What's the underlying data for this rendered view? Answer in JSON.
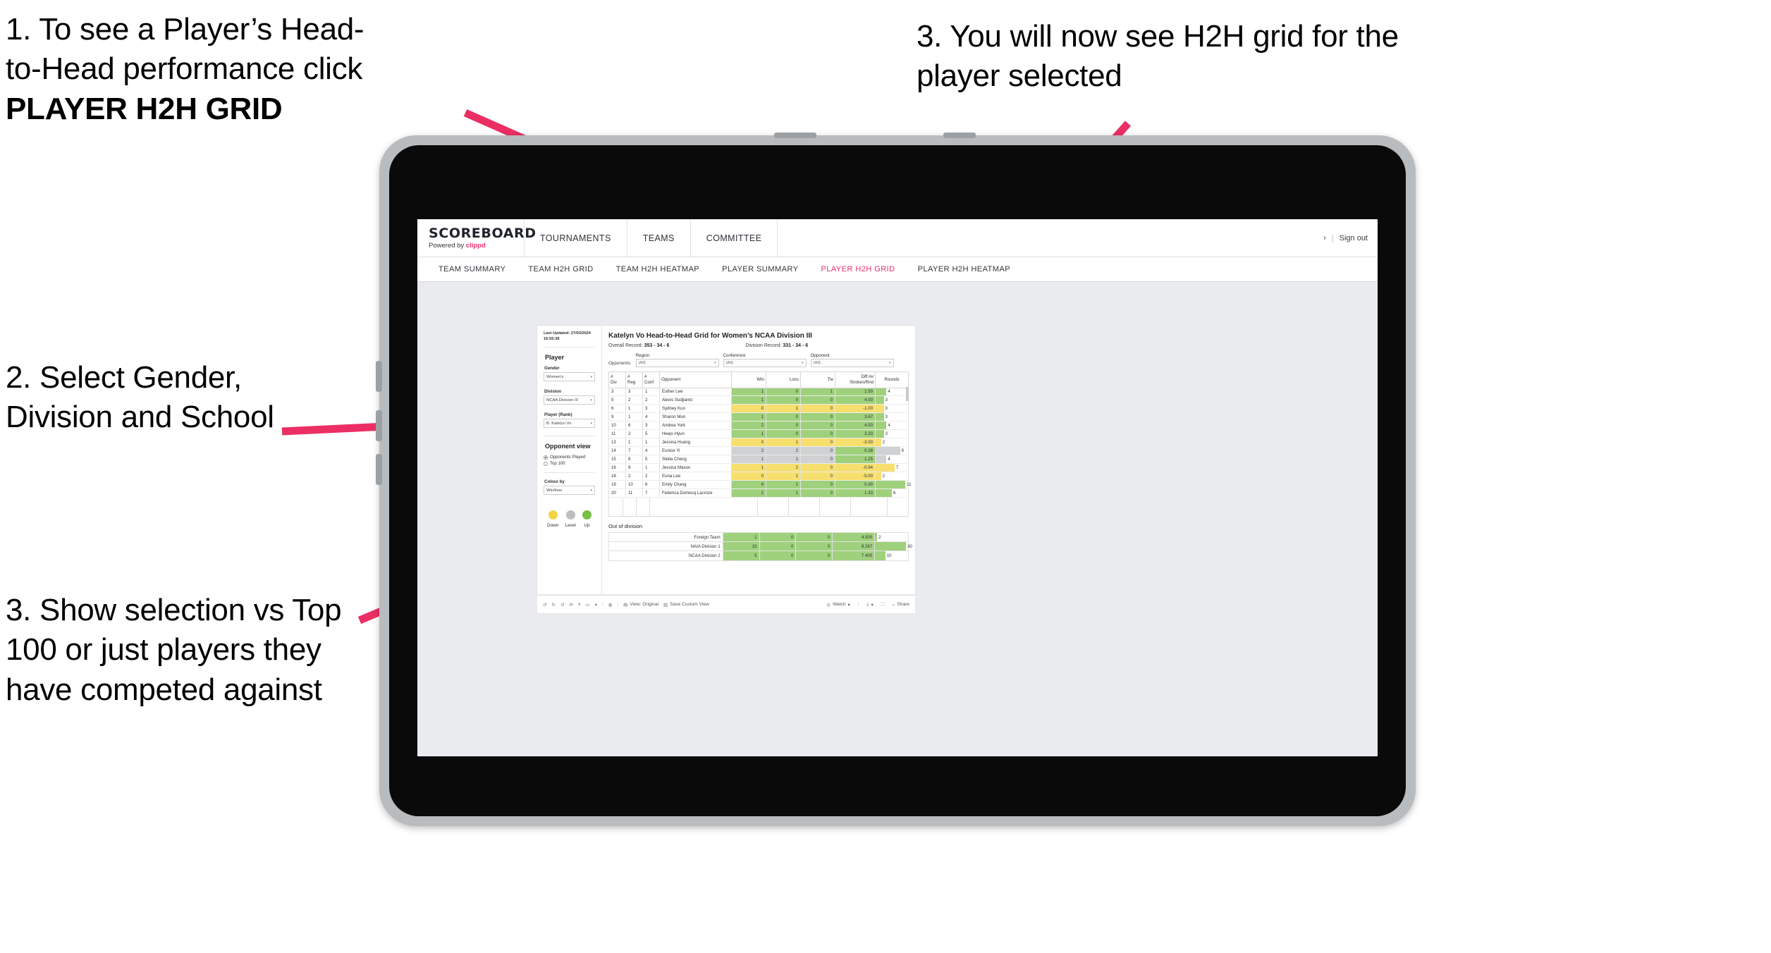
{
  "annotations": {
    "a1_line1": "1. To see a Player’s Head-",
    "a1_line2": "to-Head performance click",
    "a1_bold": "PLAYER H2H GRID",
    "a2": "2. Select Gender, Division and School",
    "a3": "3. Show selection vs Top 100 or just players they have competed against",
    "a4": "3. You will now see H2H grid for the player selected",
    "arrow_color": "#eb2f64"
  },
  "app": {
    "brand": {
      "name": "SCOREBOARD",
      "powered_prefix": "Powered by ",
      "powered_brand": "clippd"
    },
    "top_nav": [
      "TOURNAMENTS",
      "TEAMS",
      "COMMITTEE"
    ],
    "top_right": {
      "chevron": "›",
      "separator": "|",
      "sign_out": "Sign out"
    },
    "tabs": [
      {
        "label": "TEAM SUMMARY",
        "active": false
      },
      {
        "label": "TEAM H2H GRID",
        "active": false
      },
      {
        "label": "TEAM H2H HEATMAP",
        "active": false
      },
      {
        "label": "PLAYER SUMMARY",
        "active": false
      },
      {
        "label": "PLAYER H2H GRID",
        "active": true
      },
      {
        "label": "PLAYER H2H HEATMAP",
        "active": false
      }
    ],
    "accent": "#e8336d"
  },
  "sidebar": {
    "last_updated": "Last Updated: 27/03/2024 16:55:38",
    "player_heading": "Player",
    "fields": [
      {
        "label": "Gender",
        "value": "Women’s"
      },
      {
        "label": "Division",
        "value": "NCAA Division III"
      },
      {
        "label": "Player (Rank)",
        "value": "B. Katelyn Vo"
      }
    ],
    "opponent_view": {
      "heading": "Opponent view",
      "options": [
        {
          "label": "Opponents Played",
          "selected": true
        },
        {
          "label": "Top 100",
          "selected": false
        }
      ]
    },
    "colour_by": {
      "label": "Colour by",
      "value": "Win/loss"
    },
    "legend": [
      {
        "label": "Down",
        "color": "#f2d544"
      },
      {
        "label": "Level",
        "color": "#bcbec0"
      },
      {
        "label": "Up",
        "color": "#76c043"
      }
    ]
  },
  "viz": {
    "title": "Katelyn Vo Head-to-Head Grid for Women’s NCAA Division III",
    "overall_record_label": "Overall Record: ",
    "overall_record_value": "353 - 34 - 6",
    "division_record_label": "Division Record: ",
    "division_record_value": "331 - 34 - 6",
    "opponents_label": "Opponents:",
    "filters": [
      {
        "label": "Region",
        "value": "(All)"
      },
      {
        "label": "Conference",
        "value": "(All)"
      },
      {
        "label": "Opponent",
        "value": "(All)"
      }
    ],
    "out_of_division_title": "Out of division"
  },
  "chart_data": {
    "type": "table",
    "title": "Katelyn Vo Head-to-Head Grid for Women’s NCAA Division III",
    "columns": [
      "# Div",
      "# Reg",
      "# Conf",
      "Opponent",
      "Win",
      "Loss",
      "Tie",
      "Diff Av Strokes/Rnd",
      "Rounds"
    ],
    "column_headers_two_line": [
      [
        "#",
        "Div"
      ],
      [
        "#",
        "Reg"
      ],
      [
        "#",
        "Conf"
      ],
      [
        "Opponent",
        ""
      ],
      [
        "Win",
        ""
      ],
      [
        "Loss",
        ""
      ],
      [
        "Tie",
        ""
      ],
      [
        "Diff Av",
        "Strokes/Rnd"
      ],
      [
        "Rounds",
        ""
      ]
    ],
    "rounds_max": 12,
    "colors": {
      "up": "#9fd17c",
      "down": "#f7df6e",
      "level": "#cfd1d2"
    },
    "rows": [
      {
        "div": "3",
        "reg": "3",
        "conf": "1",
        "opponent": "Esther Lee",
        "win": "1",
        "loss": "0",
        "tie": "1",
        "diff": "1.50",
        "rounds": "4",
        "state": "g"
      },
      {
        "div": "5",
        "reg": "2",
        "conf": "2",
        "opponent": "Alexis Sudjianto",
        "win": "1",
        "loss": "0",
        "tie": "0",
        "diff": "4.00",
        "rounds": "3",
        "state": "g"
      },
      {
        "div": "6",
        "reg": "1",
        "conf": "3",
        "opponent": "Sydney Kuo",
        "win": "0",
        "loss": "1",
        "tie": "0",
        "diff": "-1.00",
        "rounds": "3",
        "state": "y"
      },
      {
        "div": "9",
        "reg": "1",
        "conf": "4",
        "opponent": "Sharon Mun",
        "win": "1",
        "loss": "0",
        "tie": "0",
        "diff": "3.67",
        "rounds": "3",
        "state": "g"
      },
      {
        "div": "10",
        "reg": "6",
        "conf": "3",
        "opponent": "Andrea York",
        "win": "2",
        "loss": "0",
        "tie": "0",
        "diff": "4.00",
        "rounds": "4",
        "state": "g"
      },
      {
        "div": "11",
        "reg": "2",
        "conf": "5",
        "opponent": "Heejo Hyun",
        "win": "1",
        "loss": "0",
        "tie": "0",
        "diff": "3.33",
        "rounds": "3",
        "state": "g"
      },
      {
        "div": "13",
        "reg": "1",
        "conf": "1",
        "opponent": "Jessica Huang",
        "win": "0",
        "loss": "1",
        "tie": "0",
        "diff": "-3.00",
        "rounds": "2",
        "state": "y"
      },
      {
        "div": "14",
        "reg": "7",
        "conf": "4",
        "opponent": "Eunice Yi",
        "win": "2",
        "loss": "2",
        "tie": "0",
        "diff": "0.38",
        "rounds": "9",
        "state": "n",
        "diff_state": "g"
      },
      {
        "div": "15",
        "reg": "8",
        "conf": "5",
        "opponent": "Stella Cheng",
        "win": "1",
        "loss": "1",
        "tie": "0",
        "diff": "1.25",
        "rounds": "4",
        "state": "n",
        "diff_state": "g"
      },
      {
        "div": "16",
        "reg": "9",
        "conf": "1",
        "opponent": "Jessica Mason",
        "win": "1",
        "loss": "2",
        "tie": "0",
        "diff": "-0.94",
        "rounds": "7",
        "state": "y"
      },
      {
        "div": "18",
        "reg": "2",
        "conf": "2",
        "opponent": "Euna Lee",
        "win": "0",
        "loss": "1",
        "tie": "0",
        "diff": "-5.00",
        "rounds": "2",
        "state": "y"
      },
      {
        "div": "19",
        "reg": "10",
        "conf": "6",
        "opponent": "Emily Chang",
        "win": "4",
        "loss": "1",
        "tie": "0",
        "diff": "0.30",
        "rounds": "11",
        "state": "g"
      },
      {
        "div": "20",
        "reg": "11",
        "conf": "7",
        "opponent": "Federica Domecq Lacroze",
        "win": "2",
        "loss": "1",
        "tie": "0",
        "diff": "1.33",
        "rounds": "6",
        "state": "g"
      }
    ],
    "out_of_division": {
      "title": "Out of division",
      "rounds_max": 32,
      "rows": [
        {
          "name": "Foreign Team",
          "win": "1",
          "loss": "0",
          "tie": "0",
          "diff": "4.500",
          "rounds": "2",
          "state": "g"
        },
        {
          "name": "NAIA Division 1",
          "win": "15",
          "loss": "0",
          "tie": "0",
          "diff": "9.267",
          "rounds": "30",
          "state": "g"
        },
        {
          "name": "NCAA Division 2",
          "win": "5",
          "loss": "0",
          "tie": "0",
          "diff": "7.400",
          "rounds": "10",
          "state": "g"
        }
      ]
    }
  },
  "toolbar": {
    "view_original": "View: Original",
    "save_custom_view": "Save Custom View",
    "watch": "Watch",
    "share": "Share",
    "caret": "▾"
  }
}
